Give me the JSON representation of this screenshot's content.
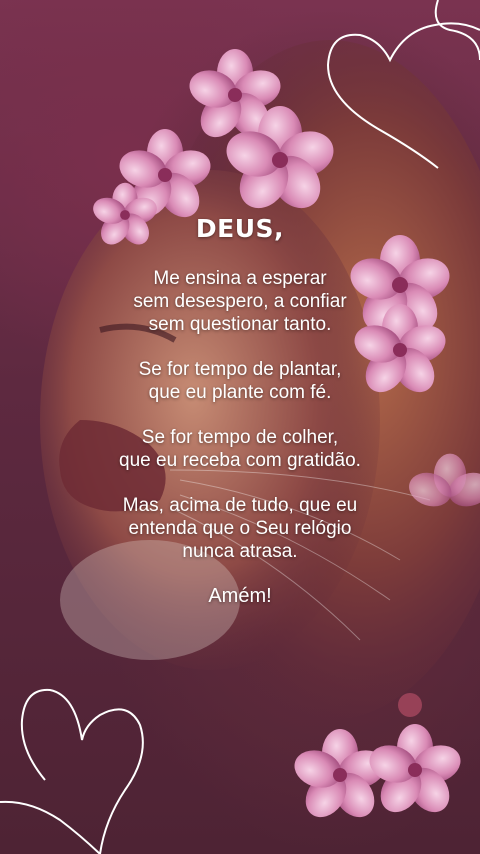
{
  "prayer": {
    "title": "DEUS,",
    "stanzas": [
      "Me ensina a esperar\nsem desespero, a confiar\nsem questionar tanto.",
      "Se for tempo de plantar,\nque eu plante com fé.",
      "Se for tempo de colher,\nque eu receba com gratidão.",
      "Mas, acima de tudo, que eu\nentenda que o Seu relógio\nnunca atrasa."
    ],
    "closing": "Amém!"
  },
  "colors": {
    "background": "#5a2538",
    "text": "#ffffff",
    "flowers": "#e7a6cc",
    "heart_line": "#ffffff"
  },
  "decorations": [
    "heart-outline-top-right",
    "heart-outline-bottom-left",
    "lion-illustration",
    "pink-flowers"
  ]
}
